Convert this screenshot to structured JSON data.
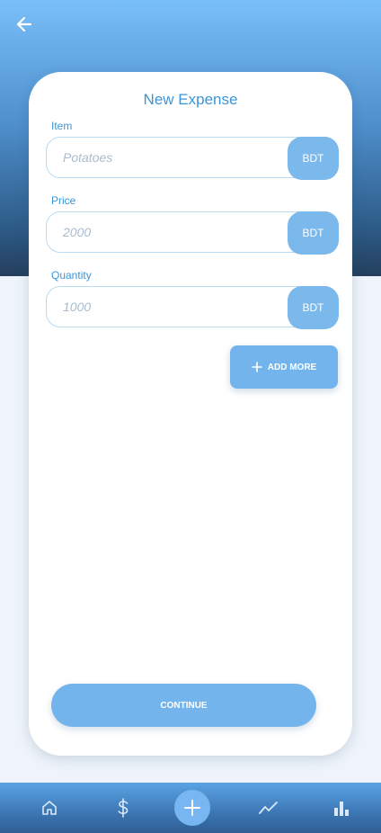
{
  "form": {
    "title": "New Expense",
    "fields": [
      {
        "label": "Item",
        "placeholder": "Potatoes",
        "unit": "BDT"
      },
      {
        "label": "Price",
        "placeholder": "2000",
        "unit": "BDT"
      },
      {
        "label": "Quantity",
        "placeholder": "1000",
        "unit": "BDT"
      }
    ],
    "add_more_label": "ADD MORE",
    "continue_label": "CONTINUE"
  },
  "icons": {
    "back": "arrow-left-icon",
    "add_more": "plus-icon",
    "nav": [
      "home-icon",
      "dollar-icon",
      "plus-icon",
      "trend-line-icon",
      "bar-chart-icon"
    ]
  },
  "colors": {
    "accent": "#3b95d8",
    "button": "#74b4ec",
    "unit_button": "#7bb8ec",
    "header_top": "#79bff8",
    "header_bottom": "#243f5c"
  }
}
